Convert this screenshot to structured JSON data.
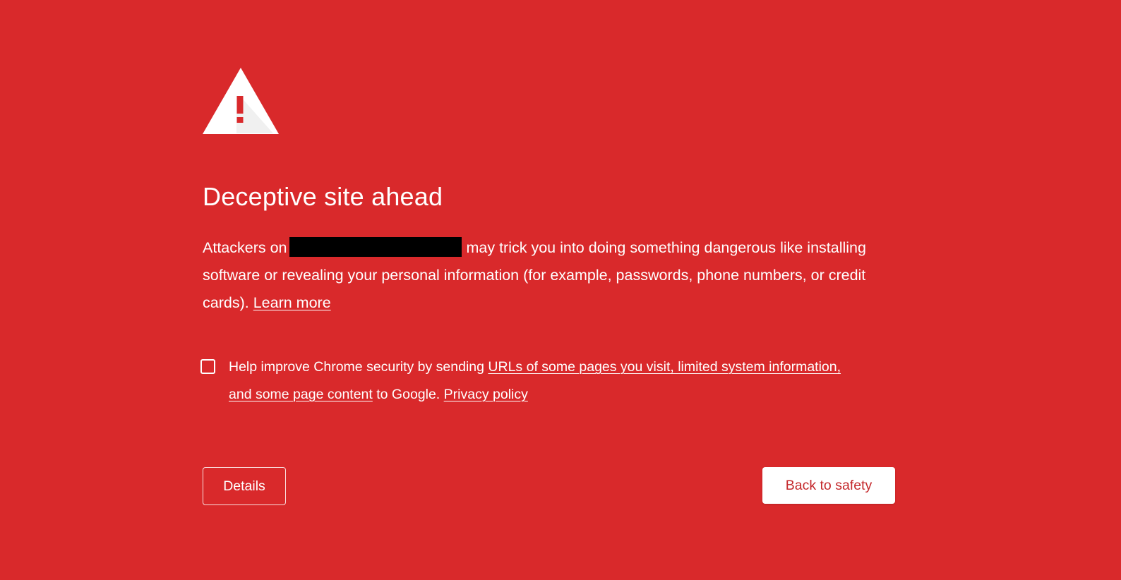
{
  "page": {
    "background_color": "#d9292b",
    "accent_text_color": "#c4282b"
  },
  "icon": {
    "name": "warning-triangle-icon"
  },
  "title": "Deceptive site ahead",
  "message": {
    "prefix": "Attackers on",
    "redacted_note": "[redacted site name]",
    "suffix": "may trick you into doing something dangerous like installing software or revealing your personal information (for example, passwords, phone numbers, or credit cards).",
    "learn_more_label": "Learn more"
  },
  "optin": {
    "checked": false,
    "text_before": "Help improve Chrome security by sending",
    "link_label": "URLs of some pages you visit, limited system information, and some page content",
    "text_after": "to Google.",
    "privacy_label": "Privacy policy"
  },
  "buttons": {
    "details_label": "Details",
    "back_to_safety_label": "Back to safety"
  }
}
